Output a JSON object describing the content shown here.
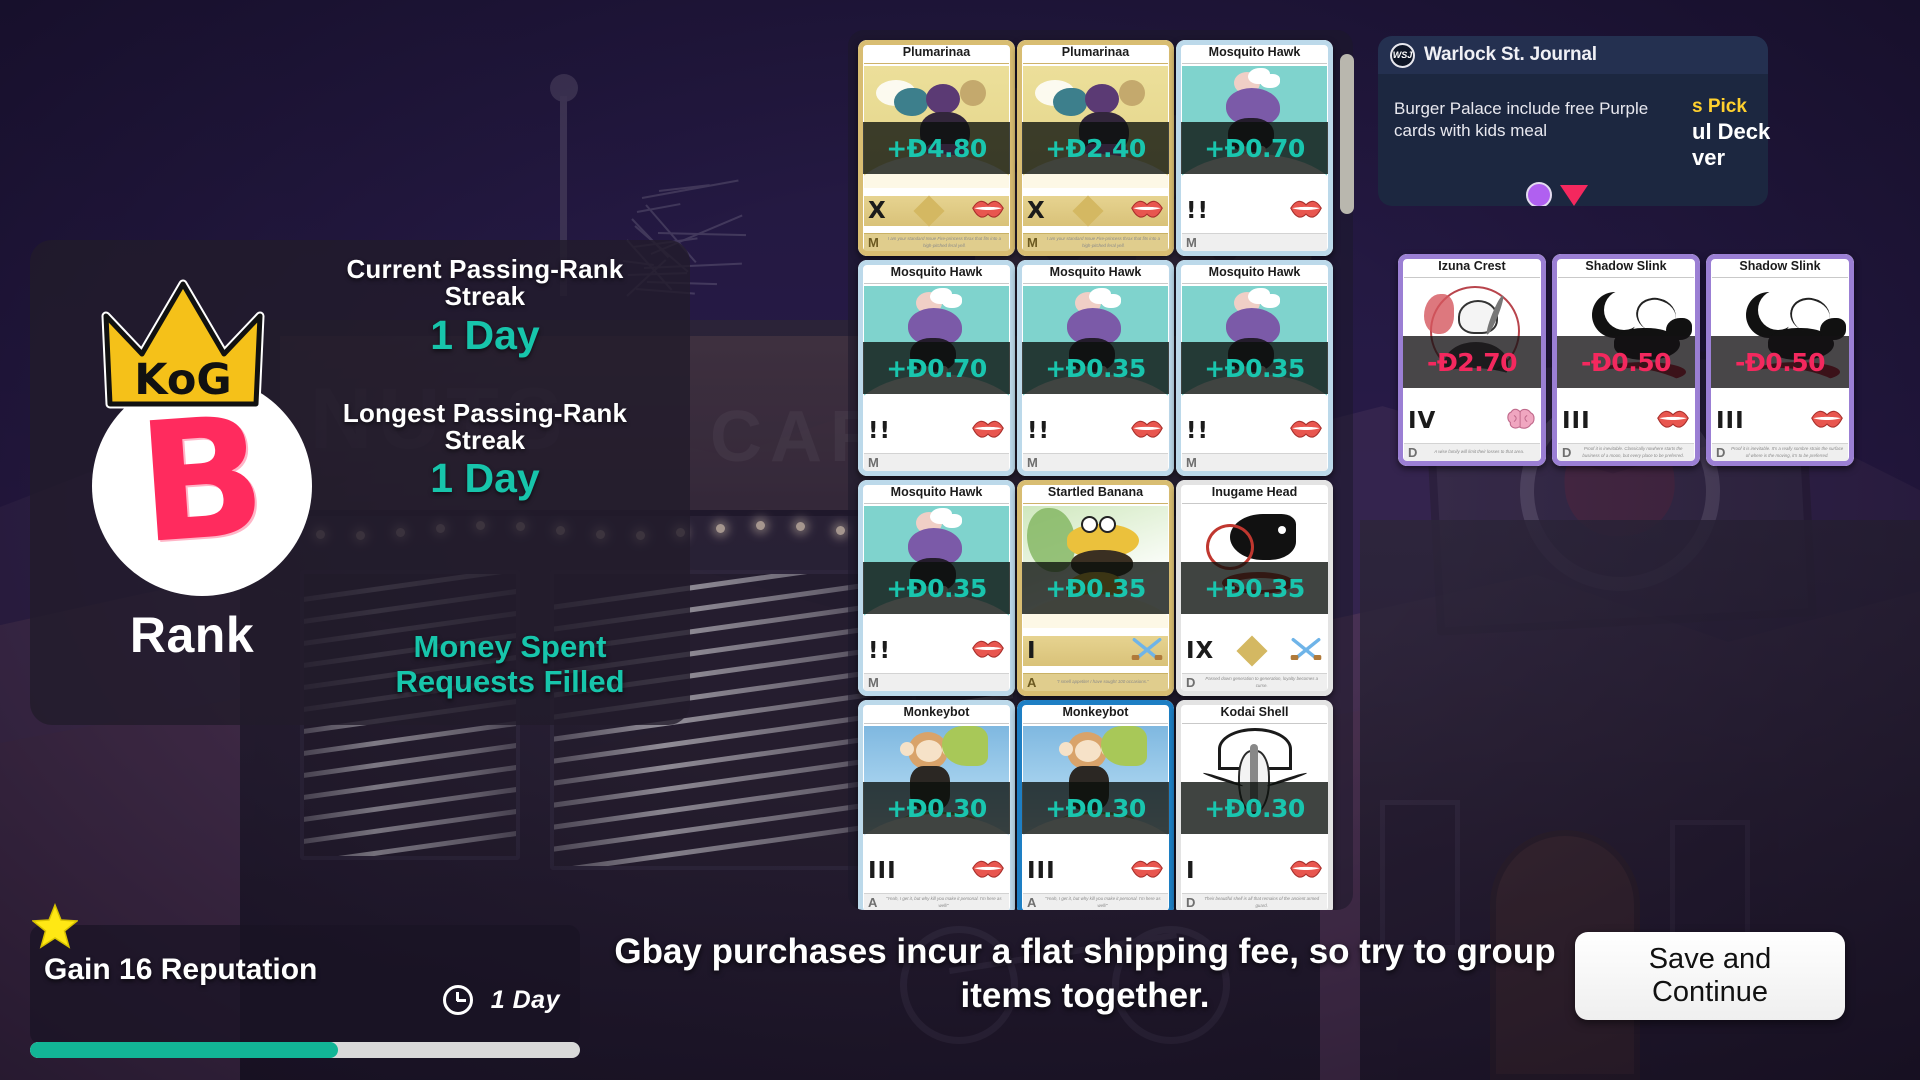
{
  "rank_panel": {
    "badge_crown_text": "KoG",
    "rank_letter": "B",
    "rank_word": "Rank",
    "current_streak_label": "Current Passing-Rank Streak",
    "current_streak_value": "1 Day",
    "longest_streak_label": "Longest Passing-Rank Streak",
    "longest_streak_value": "1 Day",
    "money_spent_label": "Money Spent",
    "requests_filled_label": "Requests Filled",
    "accent_color": "#17c5ab"
  },
  "card_grid": {
    "cards": [
      {
        "name": "Plumarinaa",
        "price": "+Ð4.80",
        "sign": "pos",
        "frame": "gold",
        "art": "gold",
        "numeral": "X",
        "icon": "lips-icon",
        "rarity": "M",
        "flavor": "I am your standard Issue Fire-princess thrax that fits into a high-pitched feral yell.",
        "diamond": true
      },
      {
        "name": "Plumarinaa",
        "price": "+Ð2.40",
        "sign": "pos",
        "frame": "gold",
        "art": "gold",
        "numeral": "X",
        "icon": "lips-icon",
        "rarity": "M",
        "flavor": "I am your standard Issue Fire-princess thrax that fits into a high-pitched feral yell.",
        "diamond": true
      },
      {
        "name": "Mosquito Hawk",
        "price": "+Ð0.70",
        "sign": "pos",
        "frame": "teal",
        "art": "teal",
        "numeral": "!!",
        "icon": "lips-icon",
        "rarity": "M",
        "flavor": "",
        "diamond": false
      },
      {
        "name": "Mosquito Hawk",
        "price": "+Ð0.70",
        "sign": "pos",
        "frame": "teal",
        "art": "teal",
        "numeral": "!!",
        "icon": "lips-icon",
        "rarity": "M",
        "flavor": "",
        "diamond": false
      },
      {
        "name": "Mosquito Hawk",
        "price": "+Ð0.35",
        "sign": "pos",
        "frame": "teal",
        "art": "teal",
        "numeral": "!!",
        "icon": "lips-icon",
        "rarity": "M",
        "flavor": "",
        "diamond": false
      },
      {
        "name": "Mosquito Hawk",
        "price": "+Ð0.35",
        "sign": "pos",
        "frame": "teal",
        "art": "teal",
        "numeral": "!!",
        "icon": "lips-icon",
        "rarity": "M",
        "flavor": "",
        "diamond": false
      },
      {
        "name": "Mosquito Hawk",
        "price": "+Ð0.35",
        "sign": "pos",
        "frame": "teal",
        "art": "teal",
        "numeral": "!!",
        "icon": "lips-icon",
        "rarity": "M",
        "flavor": "",
        "diamond": false
      },
      {
        "name": "Startled Banana",
        "price": "+Ð0.35",
        "sign": "pos",
        "frame": "gold",
        "art": "green",
        "numeral": "I",
        "icon": "swords-icon",
        "rarity": "A",
        "flavor": "\"I smell appetite! I have sought 100 occasions.\"",
        "diamond": false
      },
      {
        "name": "Inugame Head",
        "price": "+Ð0.35",
        "sign": "pos",
        "frame": "white",
        "art": "white",
        "numeral": "IX",
        "icon": "swords-icon",
        "rarity": "D",
        "flavor": "Passed down generation to generation, loyalty becomes a curse.",
        "diamond": true
      },
      {
        "name": "Monkeybot",
        "price": "+Ð0.30",
        "sign": "pos",
        "frame": "teal",
        "art": "sky",
        "numeral": "III",
        "icon": "lips-icon",
        "rarity": "A",
        "flavor": "\"Yeah, I get it, but why kill you make it personal. I'm here as well!\"",
        "diamond": false
      },
      {
        "name": "Monkeybot",
        "price": "+Ð0.30",
        "sign": "pos",
        "frame": "blue",
        "art": "sky",
        "numeral": "III",
        "icon": "lips-icon",
        "rarity": "A",
        "flavor": "\"Yeah, I get it, but why kill you make it personal. I'm here as well!\"",
        "diamond": false
      },
      {
        "name": "Kodai Shell",
        "price": "+Ð0.30",
        "sign": "pos",
        "frame": "white",
        "art": "white",
        "numeral": "I",
        "icon": "lips-icon",
        "rarity": "D",
        "flavor": "Their beautiful shell is all that remains of the ancient armed guard.",
        "diamond": false
      }
    ]
  },
  "right_cards": {
    "cards": [
      {
        "name": "Izuna Crest",
        "price": "-Ð2.70",
        "sign": "neg",
        "frame": "purple",
        "art": "white",
        "numeral": "IV",
        "icon": "brain-icon",
        "rarity": "D",
        "flavor": "A wise family will limit their losses to that area."
      },
      {
        "name": "Shadow Slink",
        "price": "-Ð0.50",
        "sign": "neg",
        "frame": "purple",
        "art": "white",
        "numeral": "III",
        "icon": "lips-icon",
        "rarity": "D",
        "flavor": "Proof it is inevitable. Classically nowhere starts the business of a moon, but every place to be preferred."
      },
      {
        "name": "Shadow Slink",
        "price": "-Ð0.50",
        "sign": "neg",
        "frame": "purple",
        "art": "white",
        "numeral": "III",
        "icon": "lips-icon",
        "rarity": "D",
        "flavor": "Proof it is inevitable. It's a really sombre strain the surface of where is the moving, it's to be preferred."
      }
    ]
  },
  "wsj": {
    "logo_text": "WSJ",
    "title": "Warlock St. Journal",
    "headline": "Burger Palace include free Purple cards with kids meal",
    "next_highlight": "s Pick",
    "next_line1": "ul Deck",
    "next_line2": "ver",
    "dot_color": "#b060f0",
    "triangle_color": "#f4285e"
  },
  "bottom": {
    "reputation_label": "Gain 16 Reputation",
    "time_value": "1 Day",
    "progress_percent": 56,
    "tip_text": "Gbay purchases incur a flat shipping fee, so try to group items together.",
    "save_button_line1": "Save and",
    "save_button_line2": "Continue",
    "progress_color": "#12b596"
  },
  "background": {
    "sign_text_1": "NUTS",
    "sign_text_2": "CARD"
  }
}
